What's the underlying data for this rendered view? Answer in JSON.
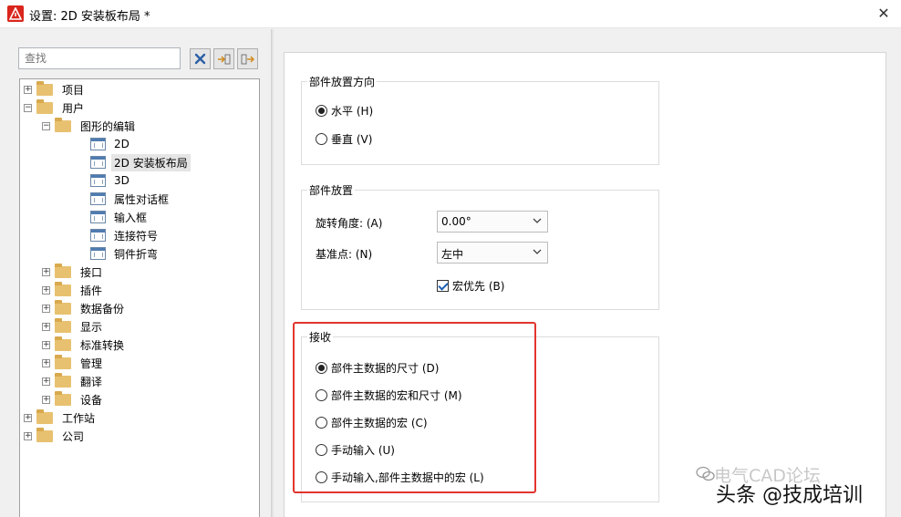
{
  "window": {
    "title": "设置: 2D 安装板布局 *",
    "close_glyph": "✕"
  },
  "left": {
    "search_placeholder": "查找",
    "tree": [
      {
        "label": "项目",
        "level": 0,
        "icon": "folder",
        "expander": "+"
      },
      {
        "label": "用户",
        "level": 0,
        "icon": "folder",
        "expander": "-"
      },
      {
        "label": "图形的编辑",
        "level": 1,
        "icon": "folder",
        "expander": "-"
      },
      {
        "label": "2D",
        "level": 2,
        "icon": "page"
      },
      {
        "label": "2D 安装板布局",
        "level": 2,
        "icon": "page",
        "selected": true
      },
      {
        "label": "3D",
        "level": 2,
        "icon": "page"
      },
      {
        "label": "属性对话框",
        "level": 2,
        "icon": "page"
      },
      {
        "label": "输入框",
        "level": 2,
        "icon": "page"
      },
      {
        "label": "连接符号",
        "level": 2,
        "icon": "page"
      },
      {
        "label": "铜件折弯",
        "level": 2,
        "icon": "page"
      },
      {
        "label": "接口",
        "level": 1,
        "icon": "folder",
        "expander": "+"
      },
      {
        "label": "插件",
        "level": 1,
        "icon": "folder",
        "expander": "+"
      },
      {
        "label": "数据备份",
        "level": 1,
        "icon": "folder",
        "expander": "+"
      },
      {
        "label": "显示",
        "level": 1,
        "icon": "folder",
        "expander": "+"
      },
      {
        "label": "标准转换",
        "level": 1,
        "icon": "folder",
        "expander": "+"
      },
      {
        "label": "管理",
        "level": 1,
        "icon": "folder",
        "expander": "+"
      },
      {
        "label": "翻译",
        "level": 1,
        "icon": "folder",
        "expander": "+"
      },
      {
        "label": "设备",
        "level": 1,
        "icon": "folder",
        "expander": "+"
      },
      {
        "label": "工作站",
        "level": 0,
        "icon": "folder",
        "expander": "+"
      },
      {
        "label": "公司",
        "level": 0,
        "icon": "folder",
        "expander": "+"
      }
    ]
  },
  "orientation": {
    "title": "部件放置方向",
    "options": [
      {
        "label": "水平 (H)",
        "checked": true
      },
      {
        "label": "垂直 (V)",
        "checked": false
      }
    ]
  },
  "placement": {
    "title": "部件放置",
    "rotation_label": "旋转角度: (A)",
    "rotation_value": "0.00°",
    "basepoint_label": "基准点: (N)",
    "basepoint_value": "左中",
    "macro_first_label": "宏优先 (B)",
    "macro_first_checked": true
  },
  "accept": {
    "title": "接收",
    "options": [
      {
        "label": "部件主数据的尺寸 (D)",
        "checked": true
      },
      {
        "label": "部件主数据的宏和尺寸 (M)",
        "checked": false
      },
      {
        "label": "部件主数据的宏 (C)",
        "checked": false
      },
      {
        "label": "手动输入  (U)",
        "checked": false
      },
      {
        "label": "手动输入,部件主数据中的宏 (L)",
        "checked": false
      }
    ]
  },
  "watermark": {
    "background_text": "电气CAD论坛",
    "main_text": "头条 @技成培训"
  },
  "colors": {
    "highlight": "#e2342e",
    "selection": "#e5e5e5"
  }
}
